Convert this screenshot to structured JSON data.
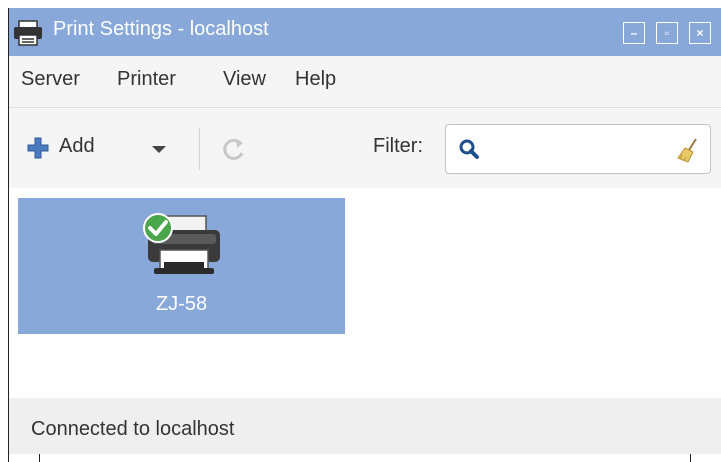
{
  "window": {
    "title": "Print Settings - localhost",
    "controls": {
      "minimize": "–",
      "maximize": "▫",
      "close": "×"
    }
  },
  "menubar": {
    "items": [
      {
        "label": "Server"
      },
      {
        "label": "Printer"
      },
      {
        "label": "View"
      },
      {
        "label": "Help"
      }
    ]
  },
  "toolbar": {
    "add_label": "Add",
    "filter_label": "Filter:",
    "filter_value": "",
    "icons": [
      "plus-icon",
      "chevron-down-icon",
      "refresh-icon",
      "search-icon",
      "broom-clear-icon"
    ]
  },
  "printers": [
    {
      "name": "ZJ-58",
      "selected": true,
      "status": "default-checkmark"
    }
  ],
  "statusbar": {
    "text": "Connected to localhost"
  },
  "colors": {
    "titlebar": "#87a8d8",
    "selection": "#87a8d8",
    "background": "#f5f5f5"
  }
}
